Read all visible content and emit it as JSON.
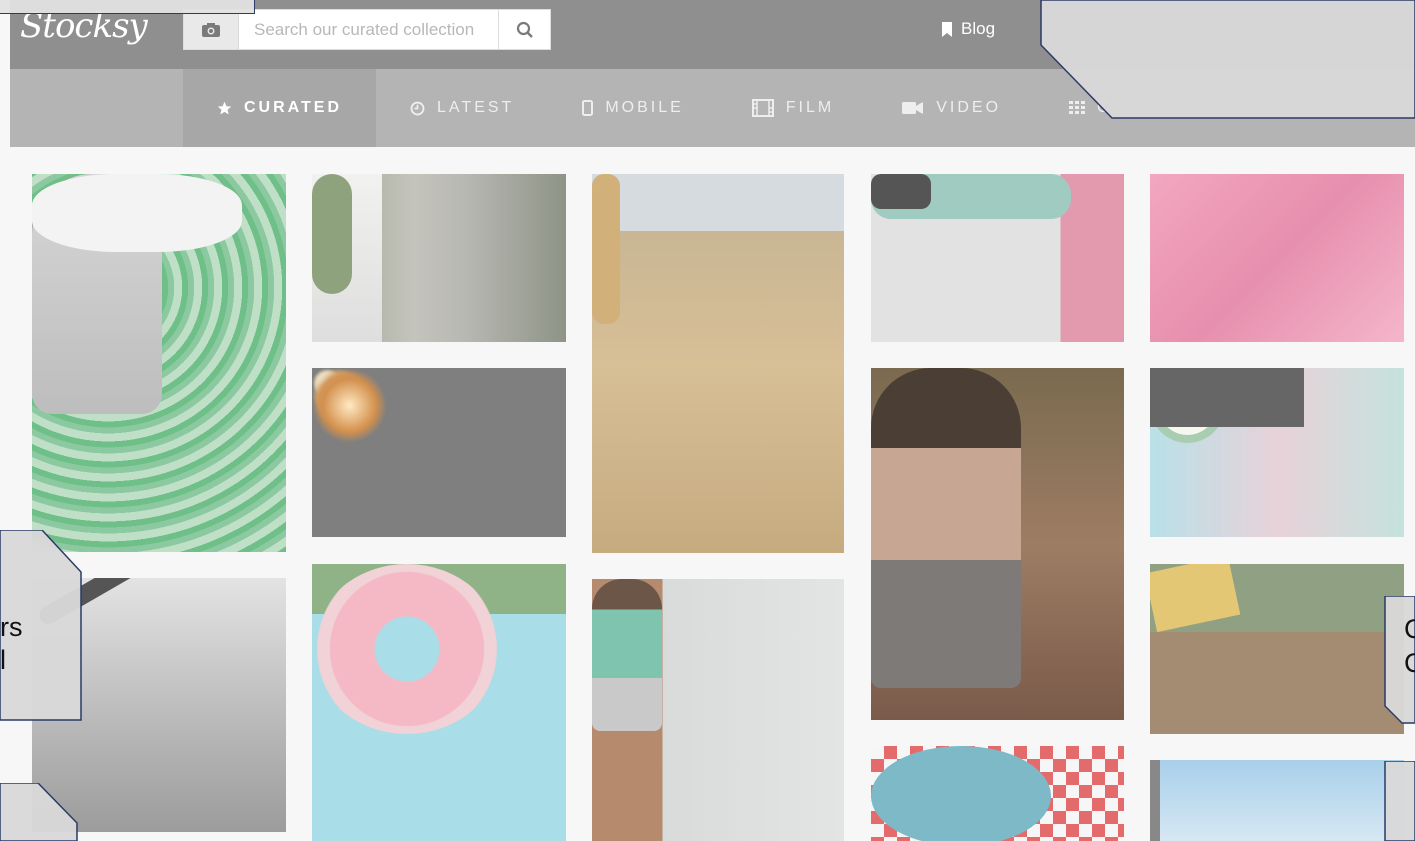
{
  "brand": {
    "logo_text": "Stocksy"
  },
  "search": {
    "placeholder": "Search our curated collection"
  },
  "header": {
    "blog_label": "Blog"
  },
  "tabs": [
    {
      "label": "CURATED",
      "icon": "star-icon",
      "active": true
    },
    {
      "label": "LATEST",
      "icon": "clock-icon",
      "active": false
    },
    {
      "label": "MOBILE",
      "icon": "mobile-icon",
      "active": false
    },
    {
      "label": "FILM",
      "icon": "film-icon",
      "active": false
    },
    {
      "label": "VIDEO",
      "icon": "video-icon",
      "active": false
    },
    {
      "label": "C",
      "icon": "grid-icon",
      "active": false
    }
  ],
  "overlays": {
    "left_text_1": "rs",
    "left_text_2": "l",
    "right_text_1": "C",
    "right_text_2": "C"
  },
  "photo_tiles": [
    "artistic-portrait-green-swirls",
    "bride-bouquet-road",
    "fireworks-night",
    "woman-desert-badlands",
    "sneakers-dental-chair",
    "pink-fabric-knife",
    "underwater-swimmer",
    "pool-donut-float",
    "boy-stairs-backpack",
    "woman-braids-drinking",
    "finger-alarm-clock",
    "go-jump-in-the-lake-sign",
    "checkered-cloth-salad",
    "sky-pole"
  ],
  "colors": {
    "topbar": "#8f8f8f",
    "navbar": "#b4b4b4",
    "active_tab": "#a7a7a7",
    "callout_border": "#2b3a66"
  }
}
